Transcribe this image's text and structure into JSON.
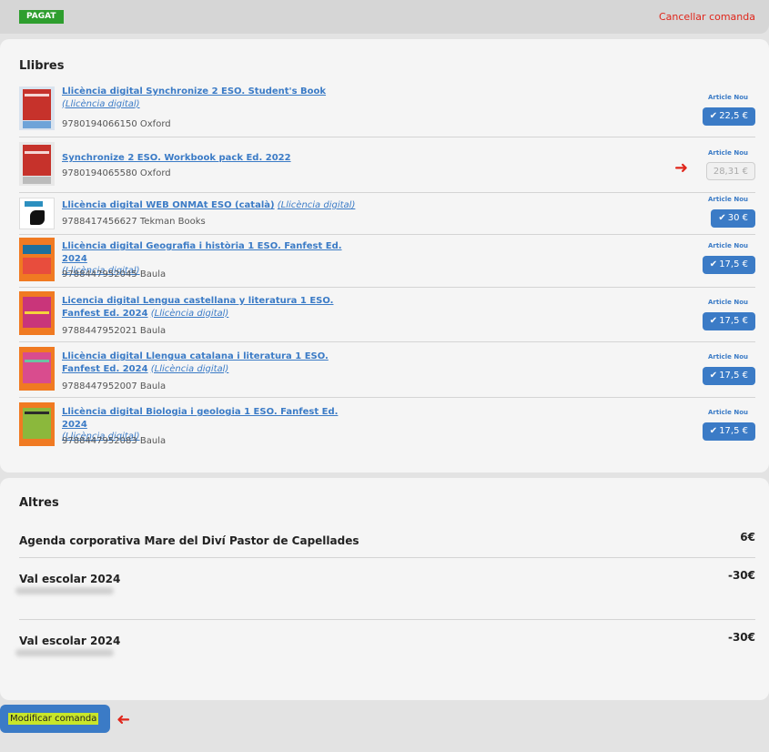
{
  "order": {
    "status_badge": "PAGAT",
    "cancel_label": "Cancellar comanda"
  },
  "books": {
    "heading": "Llibres",
    "items": [
      {
        "title": "Llicència digital Synchronize 2 ESO. Student's Book",
        "license": "(Llicència digital)",
        "isbn": "9780194066150 Oxford",
        "tag": "Article Nou",
        "price": "22,5 €",
        "selected": true,
        "cover_color": "#c6322b"
      },
      {
        "title": "Synchronize 2 ESO. Workbook pack Ed. 2022",
        "license": "",
        "isbn": "9780194065580 Oxford",
        "tag": "Article Nou",
        "price": "28,31 €",
        "selected": false,
        "cover_color": "#c6322b"
      },
      {
        "title": "Llicència digital WEB ONMAt ESO (català)",
        "license": "(Llicència digital)",
        "isbn": "9788417456627 Tekman Books",
        "tag": "Article Nou",
        "price": "30 €",
        "selected": true,
        "cover_color": "#ffffff"
      },
      {
        "title": "Llicència digital Geografia i història 1 ESO. Fanfest Ed. 2024",
        "license": "(Llicència digital)",
        "isbn": "9788447952045 Baula",
        "tag": "Article Nou",
        "price": "17,5 €",
        "selected": true,
        "cover_color": "#f07a22"
      },
      {
        "title": "Licencia digital Lengua castellana y literatura 1 ESO. Fanfest Ed. 2024",
        "license": "(Llicència digital)",
        "isbn": "9788447952021 Baula",
        "tag": "Article Nou",
        "price": "17,5 €",
        "selected": true,
        "cover_color": "#f07a22"
      },
      {
        "title": "Llicència digital Llengua catalana i literatura 1 ESO. Fanfest Ed. 2024",
        "license": "(Llicència digital)",
        "isbn": "9788447952007 Baula",
        "tag": "Article Nou",
        "price": "17,5 €",
        "selected": true,
        "cover_color": "#f07a22"
      },
      {
        "title": "Llicència digital Biologia i geologia 1 ESO. Fanfest Ed. 2024",
        "license": "(Llicència digital)",
        "isbn": "9788447952083 Baula",
        "tag": "Article Nou",
        "price": "17,5 €",
        "selected": true,
        "cover_color": "#f07a22"
      }
    ]
  },
  "others": {
    "heading": "Altres",
    "items": [
      {
        "name": "Agenda corporativa Mare del Diví Pastor de Capellades",
        "amount": "6€"
      },
      {
        "name": "Val escolar 2024",
        "amount": "-30€"
      },
      {
        "name": "Val escolar 2024",
        "amount": "-30€"
      }
    ]
  },
  "actions": {
    "modify_label": "Modificar comanda"
  },
  "colors": {
    "accent": "#3b7bc6",
    "danger": "#e0261b",
    "paid": "#2e9e2e",
    "highlight": "#c9e62a"
  }
}
